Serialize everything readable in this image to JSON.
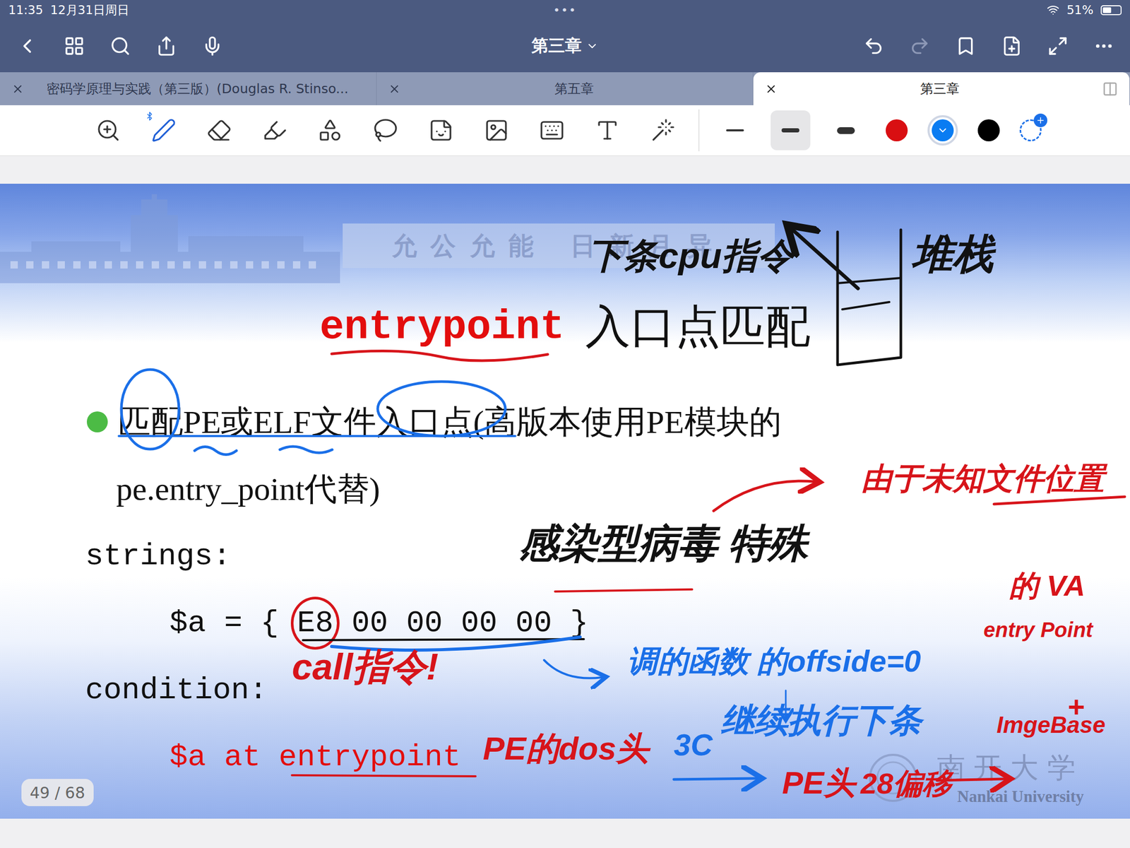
{
  "status_bar": {
    "time": "11:35",
    "date": "12月31日周日",
    "dots": "•••",
    "battery": "51%",
    "battery_level": 0.51
  },
  "nav": {
    "title": "第三章"
  },
  "tabs": [
    {
      "label": "密码学原理与实践（第三版）(Douglas R. Stinso...",
      "selected": false
    },
    {
      "label": "第五章",
      "selected": false
    },
    {
      "label": "第三章",
      "selected": true
    }
  ],
  "toolbar": {
    "tools": [
      {
        "kind": "zoom",
        "selected": false
      },
      {
        "kind": "pen",
        "selected": true
      },
      {
        "kind": "eraser",
        "selected": false
      },
      {
        "kind": "highlighter",
        "selected": false
      },
      {
        "kind": "shapes",
        "selected": false
      },
      {
        "kind": "lasso",
        "selected": false
      },
      {
        "kind": "sticker",
        "selected": false
      },
      {
        "kind": "image",
        "selected": false
      },
      {
        "kind": "keyboard",
        "selected": false
      },
      {
        "kind": "text",
        "selected": false
      },
      {
        "kind": "laser",
        "selected": false
      }
    ],
    "strokes": [
      {
        "selected": false
      },
      {
        "selected": true
      },
      {
        "selected": false
      }
    ],
    "colors": [
      {
        "color": "#d90f12",
        "selected": false
      },
      {
        "color": "#0a7cf2",
        "selected": true
      },
      {
        "color": "#000000",
        "selected": false
      }
    ]
  },
  "slide": {
    "watermark": "允公允能 日新月异",
    "title": {
      "code": "entrypoint",
      "text": "入口点匹配"
    },
    "lines": [
      {
        "kind": "bullet",
        "text": "匹配PE或ELF文件入口点(高版本使用PE模块的"
      },
      {
        "kind": "continuation",
        "text": "pe.entry_point代替)"
      },
      {
        "kind": "label",
        "text": "strings:"
      },
      {
        "kind": "hex",
        "prefix": "$a = {",
        "bytes": [
          "E8",
          "00",
          "00",
          "00",
          "00"
        ],
        "suffix": "}"
      },
      {
        "kind": "label",
        "text": "condition:"
      },
      {
        "kind": "rule",
        "text": "$a at entrypoint"
      }
    ],
    "logo": {
      "cn": "南开大学",
      "en": "Nankai University"
    }
  },
  "annotations": [
    {
      "text": "下条cpu指令",
      "color": "#111111"
    },
    {
      "text": "堆栈",
      "color": "#111111"
    },
    {
      "text": "感染型病毒 特殊",
      "color": "#111111"
    },
    {
      "text": "由于未知文件位置",
      "color": "#d7141a"
    },
    {
      "text": "的 VA",
      "color": "#d7141a"
    },
    {
      "text": "entry Point",
      "color": "#d7141a"
    },
    {
      "text": "+",
      "color": "#d7141a"
    },
    {
      "text": "ImgeBase",
      "color": "#d7141a"
    },
    {
      "text": "call指令!",
      "color": "#d7141a"
    },
    {
      "text": "调的函数 的offside=0",
      "color": "#1a6fe8"
    },
    {
      "text": "继续执行下条",
      "color": "#1a6fe8"
    },
    {
      "text": "3C",
      "color": "#1a6fe8"
    },
    {
      "text": "PE的dos头",
      "color": "#d7141a"
    },
    {
      "text": "PE头",
      "color": "#d7141a"
    },
    {
      "text": "28偏移",
      "color": "#d7141a"
    }
  ],
  "page_indicator": "49 / 68"
}
